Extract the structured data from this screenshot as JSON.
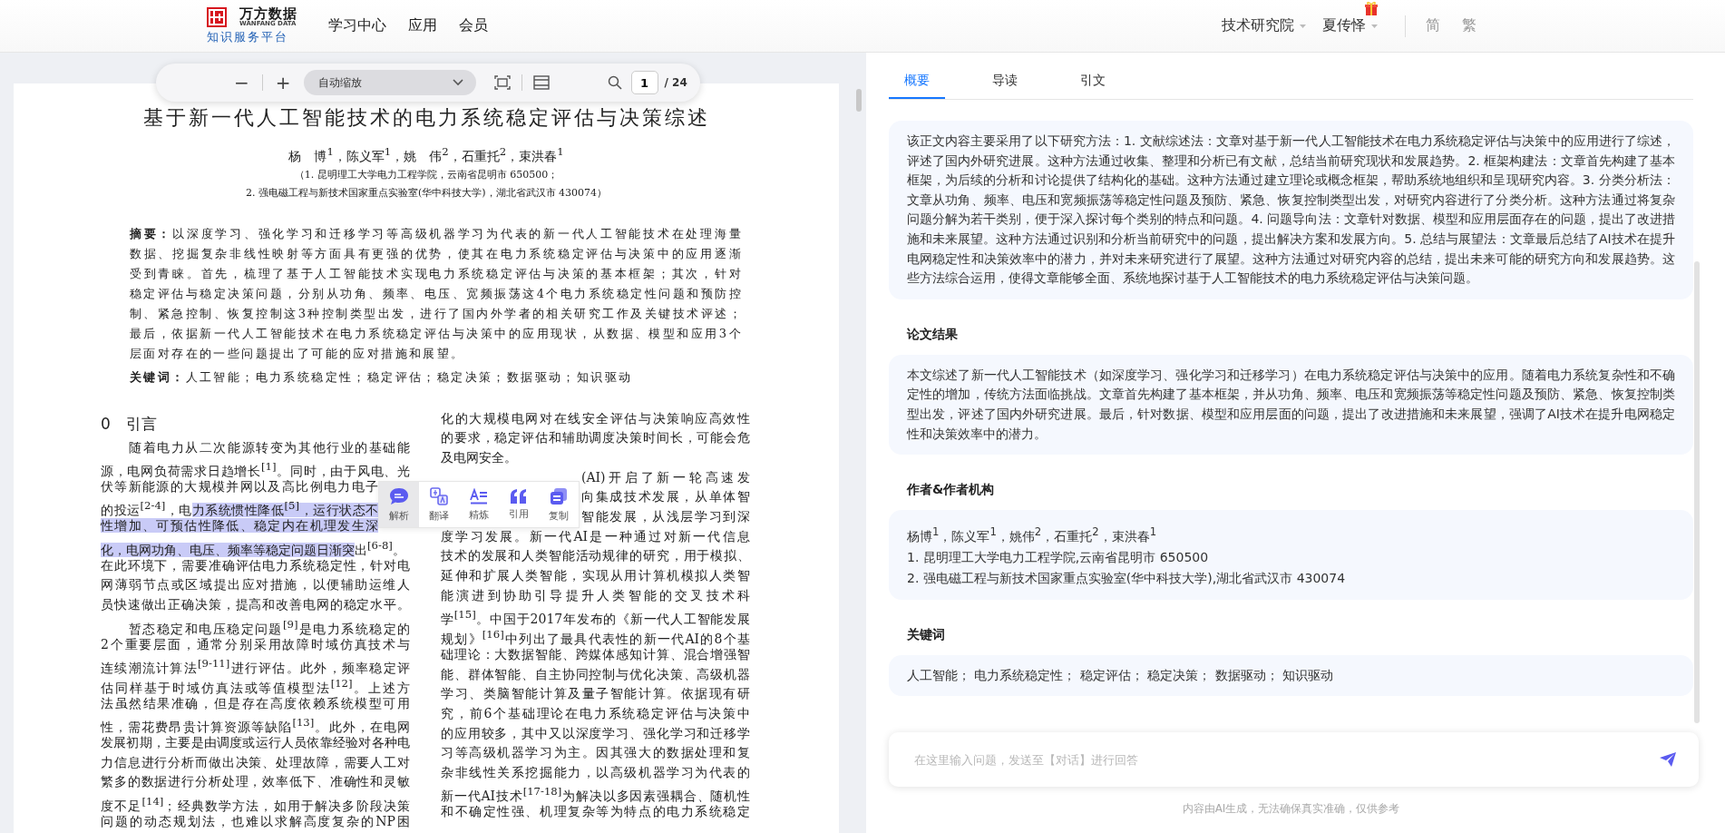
{
  "header": {
    "logo": {
      "name": "万方数据",
      "name_en": "WANFANG DATA",
      "tagline": "知识服务平台"
    },
    "nav": [
      {
        "label": "学习中心"
      },
      {
        "label": "应用"
      },
      {
        "label": "会员"
      }
    ],
    "org": "技术研究院",
    "user": "夏传怿",
    "lang": [
      {
        "label": "简"
      },
      {
        "label": "繁"
      }
    ]
  },
  "viewer_toolbar": {
    "zoom_out": "−",
    "zoom_in": "+",
    "zoom_select": "自动缩放",
    "page": "1",
    "page_total": "/ 24"
  },
  "document": {
    "title": "基于新一代人工智能技术的电力系统稳定评估与决策综述",
    "authors": "杨　博$^{1}$，陈义军$^{1}$，姚　伟$^{2}$，石重托$^{2}$，束洪春$^{1}$",
    "affiliations": [
      "（1. 昆明理工大学电力工程学院，云南省昆明市 650500；",
      "2. 强电磁工程与新技术国家重点实验室(华中科技大学)，湖北省武汉市 430074）"
    ],
    "abstract": "**摘要：**以深度学习、强化学习和迁移学习等高级机器学习为代表的新一代人工智能技术在处理海量数据、挖掘复杂非线性映射等方面具有更强的优势，使其在电力系统稳定评估与决策中的应用逐渐受到青睐。首先，梳理了基于人工智能技术实现电力系统稳定评估与决策的基本框架；其次，针对稳定评估与稳定决策问题，分别从功角、频率、电压、宽频振荡这4个电力系统稳定性问题和预防控制、紧急控制、恢复控制这3种控制类型出发，进行了国内外学者的相关研究工作及关键技术评述；最后，依据新一代人工智能技术在电力系统稳定评估与决策中的应用现状，从数据、模型和应用3个层面对存在的一些问题提出了可能的应对措施和展望。",
    "keywords": "**关键词：**人工智能；电力系统稳定性；稳定评估；稳定决策；数据驱动；知识驱动",
    "columns": [
      [
        {
          "kind": "heading",
          "text": "0　引言"
        },
        {
          "kind": "first",
          "text": "随着电力从二次能源转变为其他行业的基础能"
        },
        {
          "kind": "line",
          "text": "源，电网负荷需求日趋增长$^{[1]}$。同时，由于风电、光"
        },
        {
          "kind": "cut-right",
          "text": "伏等新能源的大规模并网以及高比例电力电子"
        },
        {
          "kind": "cut-right",
          "segments": [
            {
              "text": "的投运$^{[2-4]}$，电",
              "highlighted": false
            },
            {
              "text": "力系统惯性降低$^{[5]}$，运行状态不",
              "highlighted": true
            }
          ]
        },
        {
          "kind": "cut-right",
          "segments": [
            {
              "text": "性增加、可预估性降低、稳定内在机理发生深",
              "highlighted": true
            }
          ]
        },
        {
          "kind": "line",
          "segments": [
            {
              "text": "化，电网功角、电压、频率等稳定问题日渐突",
              "highlighted": true
            },
            {
              "text": "出$^{[6-8]}$。",
              "highlighted": false
            }
          ]
        },
        {
          "kind": "line",
          "text": "在此环境下，需要准确评估电力系统稳定性，针对电"
        },
        {
          "kind": "line",
          "text": "网薄弱节点或区域提出应对措施，以便辅助运维人"
        },
        {
          "kind": "line",
          "text": "员快速做出正确决策，提高和改善电网的稳定水平。"
        },
        {
          "kind": "first",
          "text": "暂态稳定和电压稳定问题$^{[9]}$是电力系统稳定的"
        },
        {
          "kind": "line",
          "text": "2个重要层面，通常分别采用故障时域仿真技术与"
        },
        {
          "kind": "line",
          "text": "连续潮流计算法$^{[9-11]}$进行评估。此外，频率稳定评"
        },
        {
          "kind": "line",
          "text": "估同样基于时域仿真法或等值模型法$^{[12]}$。上述方"
        },
        {
          "kind": "line",
          "text": "法虽然结果准确，但是存在高度依赖系统模型可用"
        },
        {
          "kind": "line",
          "text": "性，需花费昂贵计算资源等缺陷$^{[13]}$。此外，在电网"
        },
        {
          "kind": "line",
          "text": "发展初期，主要是由调度或运行人员依靠经验对各种电"
        },
        {
          "kind": "line",
          "text": "力信息进行分析而做出决策、处理故障，需要人工对"
        },
        {
          "kind": "line",
          "text": "繁多的数据进行分析处理，效率低下、准确性和灵敏"
        },
        {
          "kind": "line",
          "text": "度不足$^{[14]}$；经典数学方法，如用于解决多阶段决策"
        },
        {
          "kind": "line",
          "text": "问题的动态规划法，也难以求解高度复杂的NP困"
        }
      ],
      [
        {
          "kind": "line",
          "text": "化的大规模电网对在线安全评估与决策响应高效性"
        },
        {
          "kind": "line",
          "text": "的要求，稳定评估和辅助调度决策时间长，可能会危"
        },
        {
          "kind": "end",
          "text": "及电网安全。"
        },
        {
          "kind": "cut-left",
          "text": "(AI)开启了新一轮高速发"
        },
        {
          "kind": "cut-left",
          "text": "向集成技术发展，从单体智"
        },
        {
          "kind": "cut-left",
          "text": "智能发展，从浅层学习到深"
        },
        {
          "kind": "line",
          "text": "度学习发展。新一代AI是一种通过对新一代信息"
        },
        {
          "kind": "line",
          "text": "技术的发展和人类智能活动规律的研究，用于模拟、"
        },
        {
          "kind": "line",
          "text": "延伸和扩展人类智能，实现从用计算机模拟人类智"
        },
        {
          "kind": "line",
          "text": "能演进到协助引导提升人类智能的交叉技术科"
        },
        {
          "kind": "line",
          "text": "学$^{[15]}$。中国于2017年发布的《新一代人工智能发展"
        },
        {
          "kind": "line",
          "text": "规划》$^{[16]}$中列出了最具代表性的新一代AI的8个基"
        },
        {
          "kind": "line",
          "text": "础理论：大数据智能、跨媒体感知计算、混合增强智"
        },
        {
          "kind": "line",
          "text": "能、群体智能、自主协同控制与优化决策、高级机器"
        },
        {
          "kind": "line",
          "text": "学习、类脑智能计算及量子智能计算。依据现有研"
        },
        {
          "kind": "line",
          "text": "究，前6个基础理论在电力系统稳定评估与决策中"
        },
        {
          "kind": "line",
          "text": "的应用较多，其中又以深度学习、强化学习和迁移学"
        },
        {
          "kind": "line",
          "text": "习等高级机器学习为主。因其强大的数据处理和复"
        },
        {
          "kind": "line",
          "text": "杂非线性关系挖掘能力，以高级机器学习为代表的"
        },
        {
          "kind": "line",
          "text": "新一代AI技术$^{[17-18]}$为解决以多因素强耦合、随机性"
        },
        {
          "kind": "line",
          "text": "和不确定性强、机理复杂等为特点的电力系统稳定"
        }
      ]
    ]
  },
  "selection_menu": [
    {
      "label": "解析",
      "selected": true
    },
    {
      "label": "翻译",
      "selected": false
    },
    {
      "label": "精炼",
      "selected": false
    },
    {
      "label": "引用",
      "selected": false
    },
    {
      "label": "复制",
      "selected": false
    }
  ],
  "panel": {
    "tabs": [
      {
        "label": "概要",
        "selected": true
      },
      {
        "label": "导读",
        "selected": false
      },
      {
        "label": "引文",
        "selected": false
      }
    ],
    "sections": [
      {
        "paragraphs": [
          "该正文内容主要采用了以下研究方法：1. 文献综述法：文章对基于新一代人工智能技术在电力系统稳定评估与决策中的应用进行了综述，评述了国内外研究进展。这种方法通过收集、整理和分析已有文献，总结当前研究现状和发展趋势。2. 框架构建法：文章首先构建了基本框架，为后续的分析和讨论提供了结构化的基础。这种方法通过建立理论或概念框架，帮助系统地组织和呈现研究内容。3. 分类分析法：文章从功角、频率、电压和宽频振荡等稳定性问题及预防、紧急、恢复控制类型出发，对研究内容进行了分类分析。这种方法通过将复杂问题分解为若干类别，便于深入探讨每个类别的特点和问题。4. 问题导向法：文章针对数据、模型和应用层面存在的问题，提出了改进措施和未来展望。这种方法通过识别和分析当前研究中的问题，提出解决方案和发展方向。5. 总结与展望法：文章最后总结了AI技术在提升电网稳定性和决策效率中的潜力，并对未来研究进行了展望。这种方法通过对研究内容的总结，提出未来可能的研究方向和发展趋势。这些方法综合运用，使得文章能够全面、系统地探讨基于人工智能技术的电力系统稳定评估与决策问题。"
        ]
      },
      {
        "heading": "论文结果",
        "paragraphs": [
          "本文综述了新一代人工智能技术（如深度学习、强化学习和迁移学习）在电力系统稳定评估与决策中的应用。随着电力系统复杂性和不确定性的增加，传统方法面临挑战。文章首先构建了基本框架，并从功角、频率、电压和宽频振荡等稳定性问题及预防、紧急、恢复控制类型出发，评述了国内外研究进展。最后，针对数据、模型和应用层面的问题，提出了改进措施和未来展望，强调了AI技术在提升电网稳定性和决策效率中的潜力。"
        ]
      },
      {
        "heading": "作者&作者机构",
        "paragraphs": [
          "杨博$^{1}$，陈义军$^{1}$，姚伟$^{2}$，石重托$^{2}$，束洪春$^{1}$",
          "1. 昆明理工大学电力工程学院,云南省昆明市 650500",
          "2. 强电磁工程与新技术国家重点实验室(华中科技大学),湖北省武汉市 430074"
        ]
      },
      {
        "heading": "关键词",
        "paragraphs": [
          "人工智能；  电力系统稳定性；  稳定评估；  稳定决策；  数据驱动；  知识驱动"
        ]
      }
    ],
    "chat": {
      "placeholder": "在这里输入问题，发送至【对话】进行回答"
    },
    "disclaimer": "内容由AI生成，无法确保真实准确，仅供参考"
  }
}
